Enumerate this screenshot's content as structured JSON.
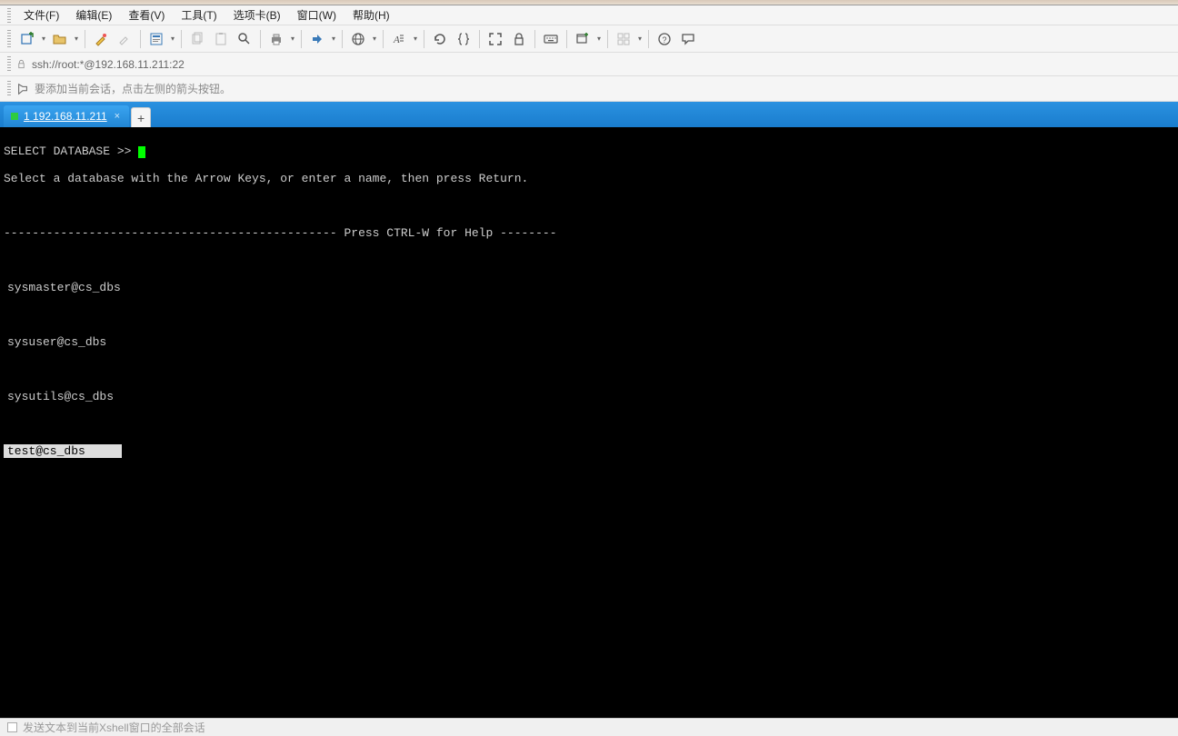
{
  "menus": {
    "file": "文件(F)",
    "edit": "编辑(E)",
    "view": "查看(V)",
    "tools": "工具(T)",
    "tabs": "选项卡(B)",
    "window": "窗口(W)",
    "help": "帮助(H)"
  },
  "address": {
    "url": "ssh://root:*@192.168.11.211:22"
  },
  "hint": {
    "text": "要添加当前会话，点击左侧的箭头按钮。"
  },
  "tabs": {
    "active": {
      "index": "1",
      "label": "192.168.11.211"
    }
  },
  "terminal": {
    "prompt": "SELECT DATABASE >>",
    "instruction": "Select a database with the Arrow Keys, or enter a name, then press Return.",
    "help_line": "----------------------------------------------- Press CTRL-W for Help --------",
    "items": [
      "sysmaster@cs_dbs",
      "sysuser@cs_dbs",
      "sysutils@cs_dbs",
      "test@cs_dbs"
    ],
    "selected_index": 3
  },
  "footer": {
    "text": "发送文本到当前Xshell窗口的全部会话"
  }
}
